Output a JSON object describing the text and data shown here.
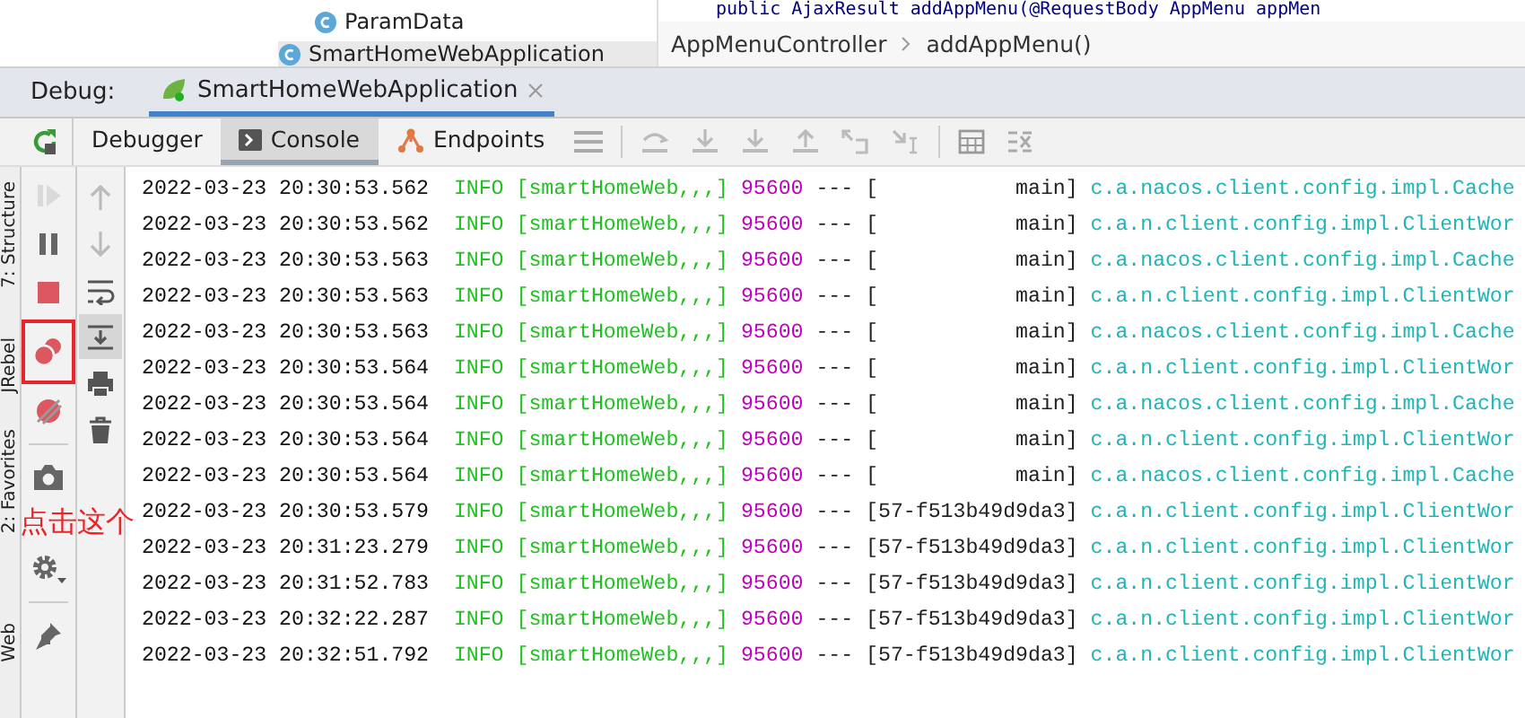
{
  "project_tree": {
    "items": [
      "ParamData",
      "SmartHomeWebApplication"
    ]
  },
  "editor": {
    "code_line": "public AjaxResult addAppMenu(@RequestBody AppMenu appMen",
    "breadcrumbs": [
      "AppMenuController",
      "addAppMenu()"
    ]
  },
  "side_tabs": [
    "7: Structure",
    "JRebel",
    "2: Favorites",
    "Web"
  ],
  "debug": {
    "label": "Debug:",
    "session_tab": {
      "title": "SmartHomeWebApplication",
      "selected": true
    }
  },
  "tabs": [
    {
      "label": "Debugger",
      "selected": false
    },
    {
      "label": "Console",
      "selected": true
    },
    {
      "label": "Endpoints",
      "selected": false
    }
  ],
  "actions": [
    {
      "kind": "resume",
      "disabled": true,
      "highlighted": false
    },
    {
      "kind": "pause",
      "disabled": false,
      "highlighted": false
    },
    {
      "kind": "stop",
      "disabled": false,
      "highlighted": false
    },
    {
      "kind": "breakpoints",
      "disabled": false,
      "highlighted": true
    },
    {
      "kind": "mute",
      "disabled": false,
      "highlighted": false
    },
    {
      "kind": "camera",
      "disabled": false,
      "highlighted": false
    },
    {
      "kind": "settings",
      "disabled": false,
      "highlighted": false
    },
    {
      "kind": "pin",
      "disabled": false,
      "highlighted": false
    }
  ],
  "console_tools": [
    {
      "kind": "up",
      "on": false
    },
    {
      "kind": "down",
      "on": false
    },
    {
      "kind": "wrap",
      "on": false
    },
    {
      "kind": "scroll-end",
      "on": true
    },
    {
      "kind": "print",
      "on": false
    },
    {
      "kind": "trash",
      "on": false
    }
  ],
  "annotation": {
    "text": "点击这个"
  },
  "log": [
    {
      "time": "2022-03-23 20:30:53.562",
      "level": "INFO",
      "app": "[smartHomeWeb,,,]",
      "pid": "95600",
      "sep": "---",
      "thread": "[           main]",
      "logger": "c.a.nacos.client.config.impl.Cache"
    },
    {
      "time": "2022-03-23 20:30:53.562",
      "level": "INFO",
      "app": "[smartHomeWeb,,,]",
      "pid": "95600",
      "sep": "---",
      "thread": "[           main]",
      "logger": "c.a.n.client.config.impl.ClientWor"
    },
    {
      "time": "2022-03-23 20:30:53.563",
      "level": "INFO",
      "app": "[smartHomeWeb,,,]",
      "pid": "95600",
      "sep": "---",
      "thread": "[           main]",
      "logger": "c.a.nacos.client.config.impl.Cache"
    },
    {
      "time": "2022-03-23 20:30:53.563",
      "level": "INFO",
      "app": "[smartHomeWeb,,,]",
      "pid": "95600",
      "sep": "---",
      "thread": "[           main]",
      "logger": "c.a.n.client.config.impl.ClientWor"
    },
    {
      "time": "2022-03-23 20:30:53.563",
      "level": "INFO",
      "app": "[smartHomeWeb,,,]",
      "pid": "95600",
      "sep": "---",
      "thread": "[           main]",
      "logger": "c.a.nacos.client.config.impl.Cache"
    },
    {
      "time": "2022-03-23 20:30:53.564",
      "level": "INFO",
      "app": "[smartHomeWeb,,,]",
      "pid": "95600",
      "sep": "---",
      "thread": "[           main]",
      "logger": "c.a.n.client.config.impl.ClientWor"
    },
    {
      "time": "2022-03-23 20:30:53.564",
      "level": "INFO",
      "app": "[smartHomeWeb,,,]",
      "pid": "95600",
      "sep": "---",
      "thread": "[           main]",
      "logger": "c.a.nacos.client.config.impl.Cache"
    },
    {
      "time": "2022-03-23 20:30:53.564",
      "level": "INFO",
      "app": "[smartHomeWeb,,,]",
      "pid": "95600",
      "sep": "---",
      "thread": "[           main]",
      "logger": "c.a.n.client.config.impl.ClientWor"
    },
    {
      "time": "2022-03-23 20:30:53.564",
      "level": "INFO",
      "app": "[smartHomeWeb,,,]",
      "pid": "95600",
      "sep": "---",
      "thread": "[           main]",
      "logger": "c.a.nacos.client.config.impl.Cache"
    },
    {
      "time": "2022-03-23 20:30:53.579",
      "level": "INFO",
      "app": "[smartHomeWeb,,,]",
      "pid": "95600",
      "sep": "---",
      "thread": "[57-f513b49d9da3]",
      "logger": "c.a.n.client.config.impl.ClientWor"
    },
    {
      "time": "2022-03-23 20:31:23.279",
      "level": "INFO",
      "app": "[smartHomeWeb,,,]",
      "pid": "95600",
      "sep": "---",
      "thread": "[57-f513b49d9da3]",
      "logger": "c.a.n.client.config.impl.ClientWor"
    },
    {
      "time": "2022-03-23 20:31:52.783",
      "level": "INFO",
      "app": "[smartHomeWeb,,,]",
      "pid": "95600",
      "sep": "---",
      "thread": "[57-f513b49d9da3]",
      "logger": "c.a.n.client.config.impl.ClientWor"
    },
    {
      "time": "2022-03-23 20:32:22.287",
      "level": "INFO",
      "app": "[smartHomeWeb,,,]",
      "pid": "95600",
      "sep": "---",
      "thread": "[57-f513b49d9da3]",
      "logger": "c.a.n.client.config.impl.ClientWor"
    },
    {
      "time": "2022-03-23 20:32:51.792",
      "level": "INFO",
      "app": "[smartHomeWeb,,,]",
      "pid": "95600",
      "sep": "---",
      "thread": "[57-f513b49d9da3]",
      "logger": "c.a.n.client.config.impl.ClientWor"
    }
  ]
}
